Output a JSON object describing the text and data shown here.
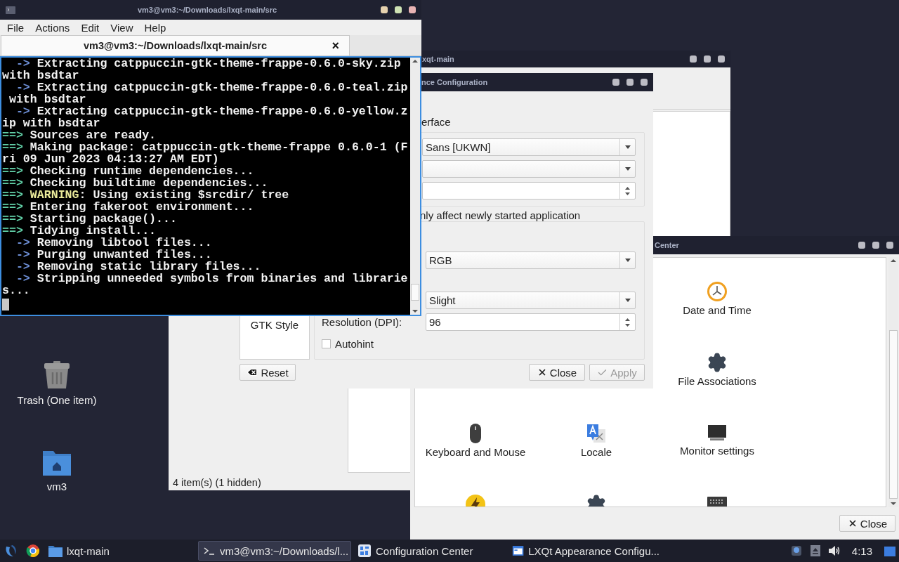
{
  "terminal": {
    "title": "vm3@vm3:~/Downloads/lxqt-main/src",
    "menu": [
      "File",
      "Actions",
      "Edit",
      "View",
      "Help"
    ],
    "tab": {
      "label": "vm3@vm3:~/Downloads/lxqt-main/src",
      "close": "×"
    },
    "lines": [
      {
        "kind": "step",
        "prefix": "  ->",
        "text": " Extracting catppuccin-gtk-theme-frappe-0.6.0-sky.zip"
      },
      {
        "text": "with bsdtar"
      },
      {
        "kind": "step",
        "prefix": "  ->",
        "text": " Extracting catppuccin-gtk-theme-frappe-0.6.0-teal.zip"
      },
      {
        "text": " with bsdtar"
      },
      {
        "kind": "step",
        "prefix": "  ->",
        "text": " Extracting catppuccin-gtk-theme-frappe-0.6.0-yellow.z"
      },
      {
        "text": "ip with bsdtar"
      },
      {
        "kind": "section",
        "prefix": "==>",
        "text": " Sources are ready."
      },
      {
        "kind": "section",
        "prefix": "==>",
        "text": " Making package: catppuccin-gtk-theme-frappe 0.6.0-1 (F"
      },
      {
        "text": "ri 09 Jun 2023 04:13:27 AM EDT)"
      },
      {
        "kind": "section",
        "prefix": "==>",
        "text": " Checking runtime dependencies..."
      },
      {
        "kind": "section",
        "prefix": "==>",
        "text": " Checking buildtime dependencies..."
      },
      {
        "kind": "section",
        "prefix": "==>",
        "highlight": " WARNING",
        "text": ": Using existing $srcdir/ tree"
      },
      {
        "kind": "section",
        "prefix": "==>",
        "text": " Entering fakeroot environment..."
      },
      {
        "kind": "section",
        "prefix": "==>",
        "text": " Starting package()..."
      },
      {
        "kind": "section",
        "prefix": "==>",
        "text": " Tidying install..."
      },
      {
        "kind": "step",
        "prefix": "  ->",
        "text": " Removing libtool files..."
      },
      {
        "kind": "step",
        "prefix": "  ->",
        "text": " Purging unwanted files..."
      },
      {
        "kind": "step",
        "prefix": "  ->",
        "text": " Removing static library files..."
      },
      {
        "kind": "step",
        "prefix": "  ->",
        "text": " Stripping unneeded symbols from binaries and librarie"
      },
      {
        "text": "s..."
      }
    ]
  },
  "file_manager": {
    "title": "xqt-main",
    "status": "4 item(s) (1 hidden)"
  },
  "appearance": {
    "title": "nce Configuration",
    "sidebar_item": "GTK Style",
    "group_title": "erface",
    "font_name": "Sans [UKWN]",
    "note": "nly affect newly started application",
    "subpixel": "RGB",
    "hinting": "Slight",
    "dpi_label": "Resolution (DPI):",
    "dpi": "96",
    "autohint": {
      "label": "Autohint",
      "checked": false
    },
    "buttons": {
      "reset": "Reset",
      "close": "Close",
      "apply": "Apply",
      "apply_disabled": true
    }
  },
  "config_center": {
    "title": "Center",
    "rows": [
      {
        "items": [
          {
            "label": "Date and Time",
            "kind": "clock"
          }
        ]
      },
      {
        "items": [
          {
            "label": "File Associations",
            "kind": "gear"
          }
        ]
      },
      {
        "items": [
          {
            "label": "Keyboard and Mouse",
            "kind": "mouse"
          },
          {
            "label": "Locale",
            "kind": "locale"
          },
          {
            "label": "Monitor settings",
            "kind": "monitor"
          }
        ]
      },
      {
        "items": [
          {
            "kind": "power"
          },
          {
            "kind": "gear"
          },
          {
            "kind": "keyboard"
          }
        ]
      }
    ],
    "close_button": "Close"
  },
  "desktop": {
    "icons": [
      {
        "label": "Trash (One item)",
        "kind": "trash"
      },
      {
        "label": "vm3",
        "kind": "home"
      }
    ]
  },
  "taskbar": {
    "tasks": [
      {
        "label": "lxqt-main",
        "kind": "folder",
        "selected": false
      },
      {
        "label": "vm3@vm3:~/Downloads/l...",
        "kind": "terminal",
        "selected": true
      },
      {
        "label": "Configuration Center",
        "kind": "config",
        "selected": false
      },
      {
        "label": "LXQt Appearance Configu...",
        "kind": "appearance",
        "selected": false
      }
    ],
    "clock": "4:13"
  }
}
